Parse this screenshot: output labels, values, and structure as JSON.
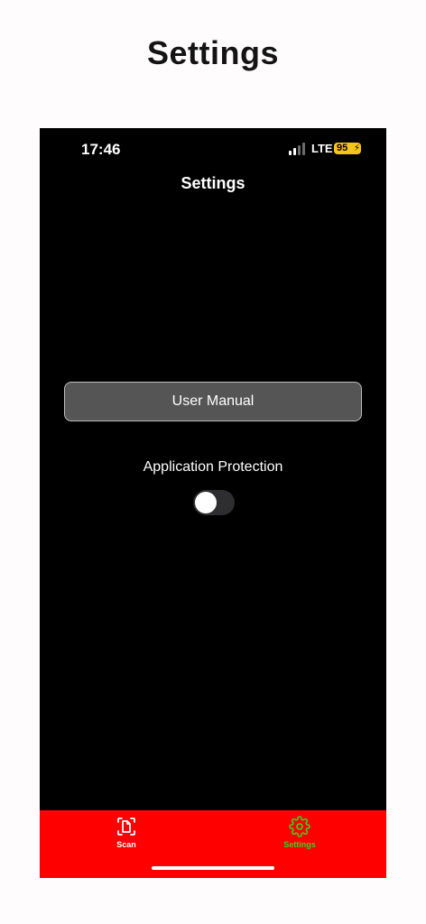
{
  "page": {
    "heading": "Settings"
  },
  "status_bar": {
    "time": "17:46",
    "network": "LTE",
    "battery": "95"
  },
  "screen": {
    "title": "Settings",
    "user_manual_label": "User Manual",
    "protection_label": "Application Protection",
    "protection_enabled": false
  },
  "tab_bar": {
    "tabs": [
      {
        "label": "Scan",
        "icon": "scan-document-icon",
        "active": false
      },
      {
        "label": "Settings",
        "icon": "gear-icon",
        "active": true
      }
    ]
  },
  "colors": {
    "tab_bar_bg": "#ff0000",
    "active_tab": "#22dd22",
    "inactive_tab": "#ffffff",
    "battery": "#f5c518",
    "button_bg": "#555555"
  }
}
